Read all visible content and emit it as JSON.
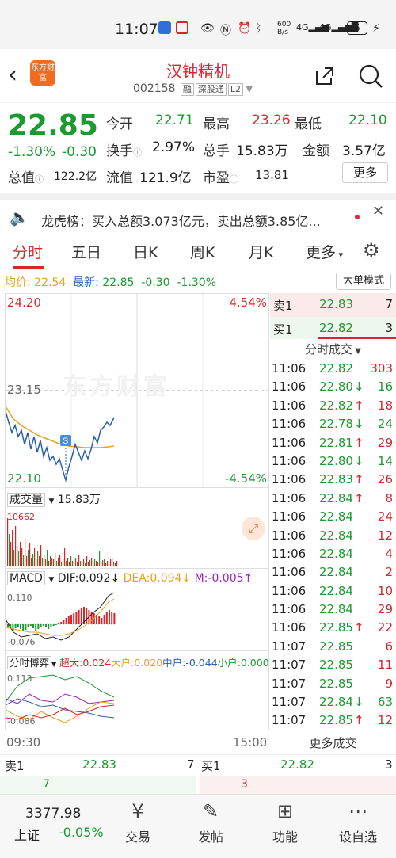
{
  "status": {
    "time": "11:07",
    "battery": "5",
    "speed": "600 B/s"
  },
  "header": {
    "title": "汉钟精机",
    "code": "002158",
    "tags": [
      "融",
      "深股通",
      "L2"
    ],
    "logo_text": "东方财富"
  },
  "quote": {
    "price": "22.85",
    "pct": "-1.30%",
    "chg": "-0.30",
    "open_label": "今开",
    "open": "22.71",
    "high_label": "最高",
    "high": "23.26",
    "low_label": "最低",
    "low": "22.10",
    "turnover_label": "换手",
    "turnover": "2.97%",
    "volume_label": "总手",
    "volume": "15.83万",
    "amount_label": "金额",
    "amount": "3.57亿",
    "mktcap_label": "总值",
    "mktcap": "122.2亿",
    "float_label": "流值",
    "float": "121.9亿",
    "pe_label": "市盈",
    "pe": "13.81",
    "more": "更多"
  },
  "notice": {
    "text": "龙虎榜：买入总额3.073亿元，卖出总额3.85亿..."
  },
  "tabs": [
    "分时",
    "五日",
    "日K",
    "周K",
    "月K",
    "更多"
  ],
  "avg": {
    "avg_label": "均价:",
    "avg": "22.54",
    "latest_label": "最新:",
    "latest": "22.85",
    "chg": "-0.30",
    "pct": "-1.30%",
    "bigorder": "大单模式"
  },
  "chart": {
    "top_price": "24.20",
    "top_pct": "4.54%",
    "mid_price": "23.15",
    "bot_price": "22.10",
    "bot_pct": "-4.54%",
    "watermark": "东方财富",
    "start_time": "09:30",
    "end_time": "15:00",
    "s_marker": "S"
  },
  "vol": {
    "label": "成交量",
    "value": "15.83万",
    "max": "10662"
  },
  "macd": {
    "label": "MACD",
    "dif": "DIF:0.092↓",
    "dea": "DEA:0.094↓",
    "m": "M:-0.005↑",
    "top": "0.110",
    "bot": "-0.076"
  },
  "game": {
    "label": "分时博弈",
    "super": "超大:0.024",
    "large": "大户:0.020",
    "mid": "中户:-0.044",
    "small": "小户:0.000",
    "top": "0.113",
    "bot": "-0.086"
  },
  "book": {
    "sell_label": "卖1",
    "sell_price": "22.83",
    "sell_vol": "7",
    "buy_label": "买1",
    "buy_price": "22.82",
    "buy_vol": "3"
  },
  "ticks_title": "分时成交",
  "ticks": [
    {
      "t": "11:06",
      "p": "22.82",
      "a": "",
      "v": "303",
      "c": "r"
    },
    {
      "t": "11:06",
      "p": "22.80",
      "a": "↓",
      "v": "16",
      "c": "g"
    },
    {
      "t": "11:06",
      "p": "22.82",
      "a": "↑",
      "v": "18",
      "c": "r"
    },
    {
      "t": "11:06",
      "p": "22.78",
      "a": "↓",
      "v": "24",
      "c": "g"
    },
    {
      "t": "11:06",
      "p": "22.81",
      "a": "↑",
      "v": "29",
      "c": "r"
    },
    {
      "t": "11:06",
      "p": "22.80",
      "a": "↓",
      "v": "14",
      "c": "g"
    },
    {
      "t": "11:06",
      "p": "22.83",
      "a": "↑",
      "v": "26",
      "c": "r"
    },
    {
      "t": "11:06",
      "p": "22.84",
      "a": "↑",
      "v": "8",
      "c": "r"
    },
    {
      "t": "11:06",
      "p": "22.84",
      "a": "",
      "v": "24",
      "c": "r"
    },
    {
      "t": "11:06",
      "p": "22.84",
      "a": "",
      "v": "12",
      "c": "r"
    },
    {
      "t": "11:06",
      "p": "22.84",
      "a": "",
      "v": "4",
      "c": "r"
    },
    {
      "t": "11:06",
      "p": "22.84",
      "a": "",
      "v": "2",
      "c": "r"
    },
    {
      "t": "11:06",
      "p": "22.84",
      "a": "",
      "v": "10",
      "c": "r"
    },
    {
      "t": "11:06",
      "p": "22.84",
      "a": "",
      "v": "29",
      "c": "r"
    },
    {
      "t": "11:06",
      "p": "22.85",
      "a": "↑",
      "v": "22",
      "c": "r"
    },
    {
      "t": "11:07",
      "p": "22.85",
      "a": "",
      "v": "6",
      "c": "r"
    },
    {
      "t": "11:07",
      "p": "22.85",
      "a": "",
      "v": "11",
      "c": "r"
    },
    {
      "t": "11:07",
      "p": "22.85",
      "a": "",
      "v": "9",
      "c": "r"
    },
    {
      "t": "11:07",
      "p": "22.84",
      "a": "↓",
      "v": "63",
      "c": "g"
    },
    {
      "t": "11:07",
      "p": "22.85",
      "a": "↑",
      "v": "12",
      "c": "r"
    }
  ],
  "more_ticks": "更多成交",
  "bottom_book": {
    "sell_label": "卖1",
    "sell_price": "22.83",
    "sell_vol": "7",
    "sell_depth": "7",
    "buy_label": "买1",
    "buy_price": "22.82",
    "buy_vol": "3",
    "buy_depth": "3"
  },
  "nav": {
    "index_value": "3377.98",
    "index_name": "上证",
    "index_pct": "-0.05%",
    "items": [
      "交易",
      "发帖",
      "功能",
      "设自选"
    ]
  }
}
